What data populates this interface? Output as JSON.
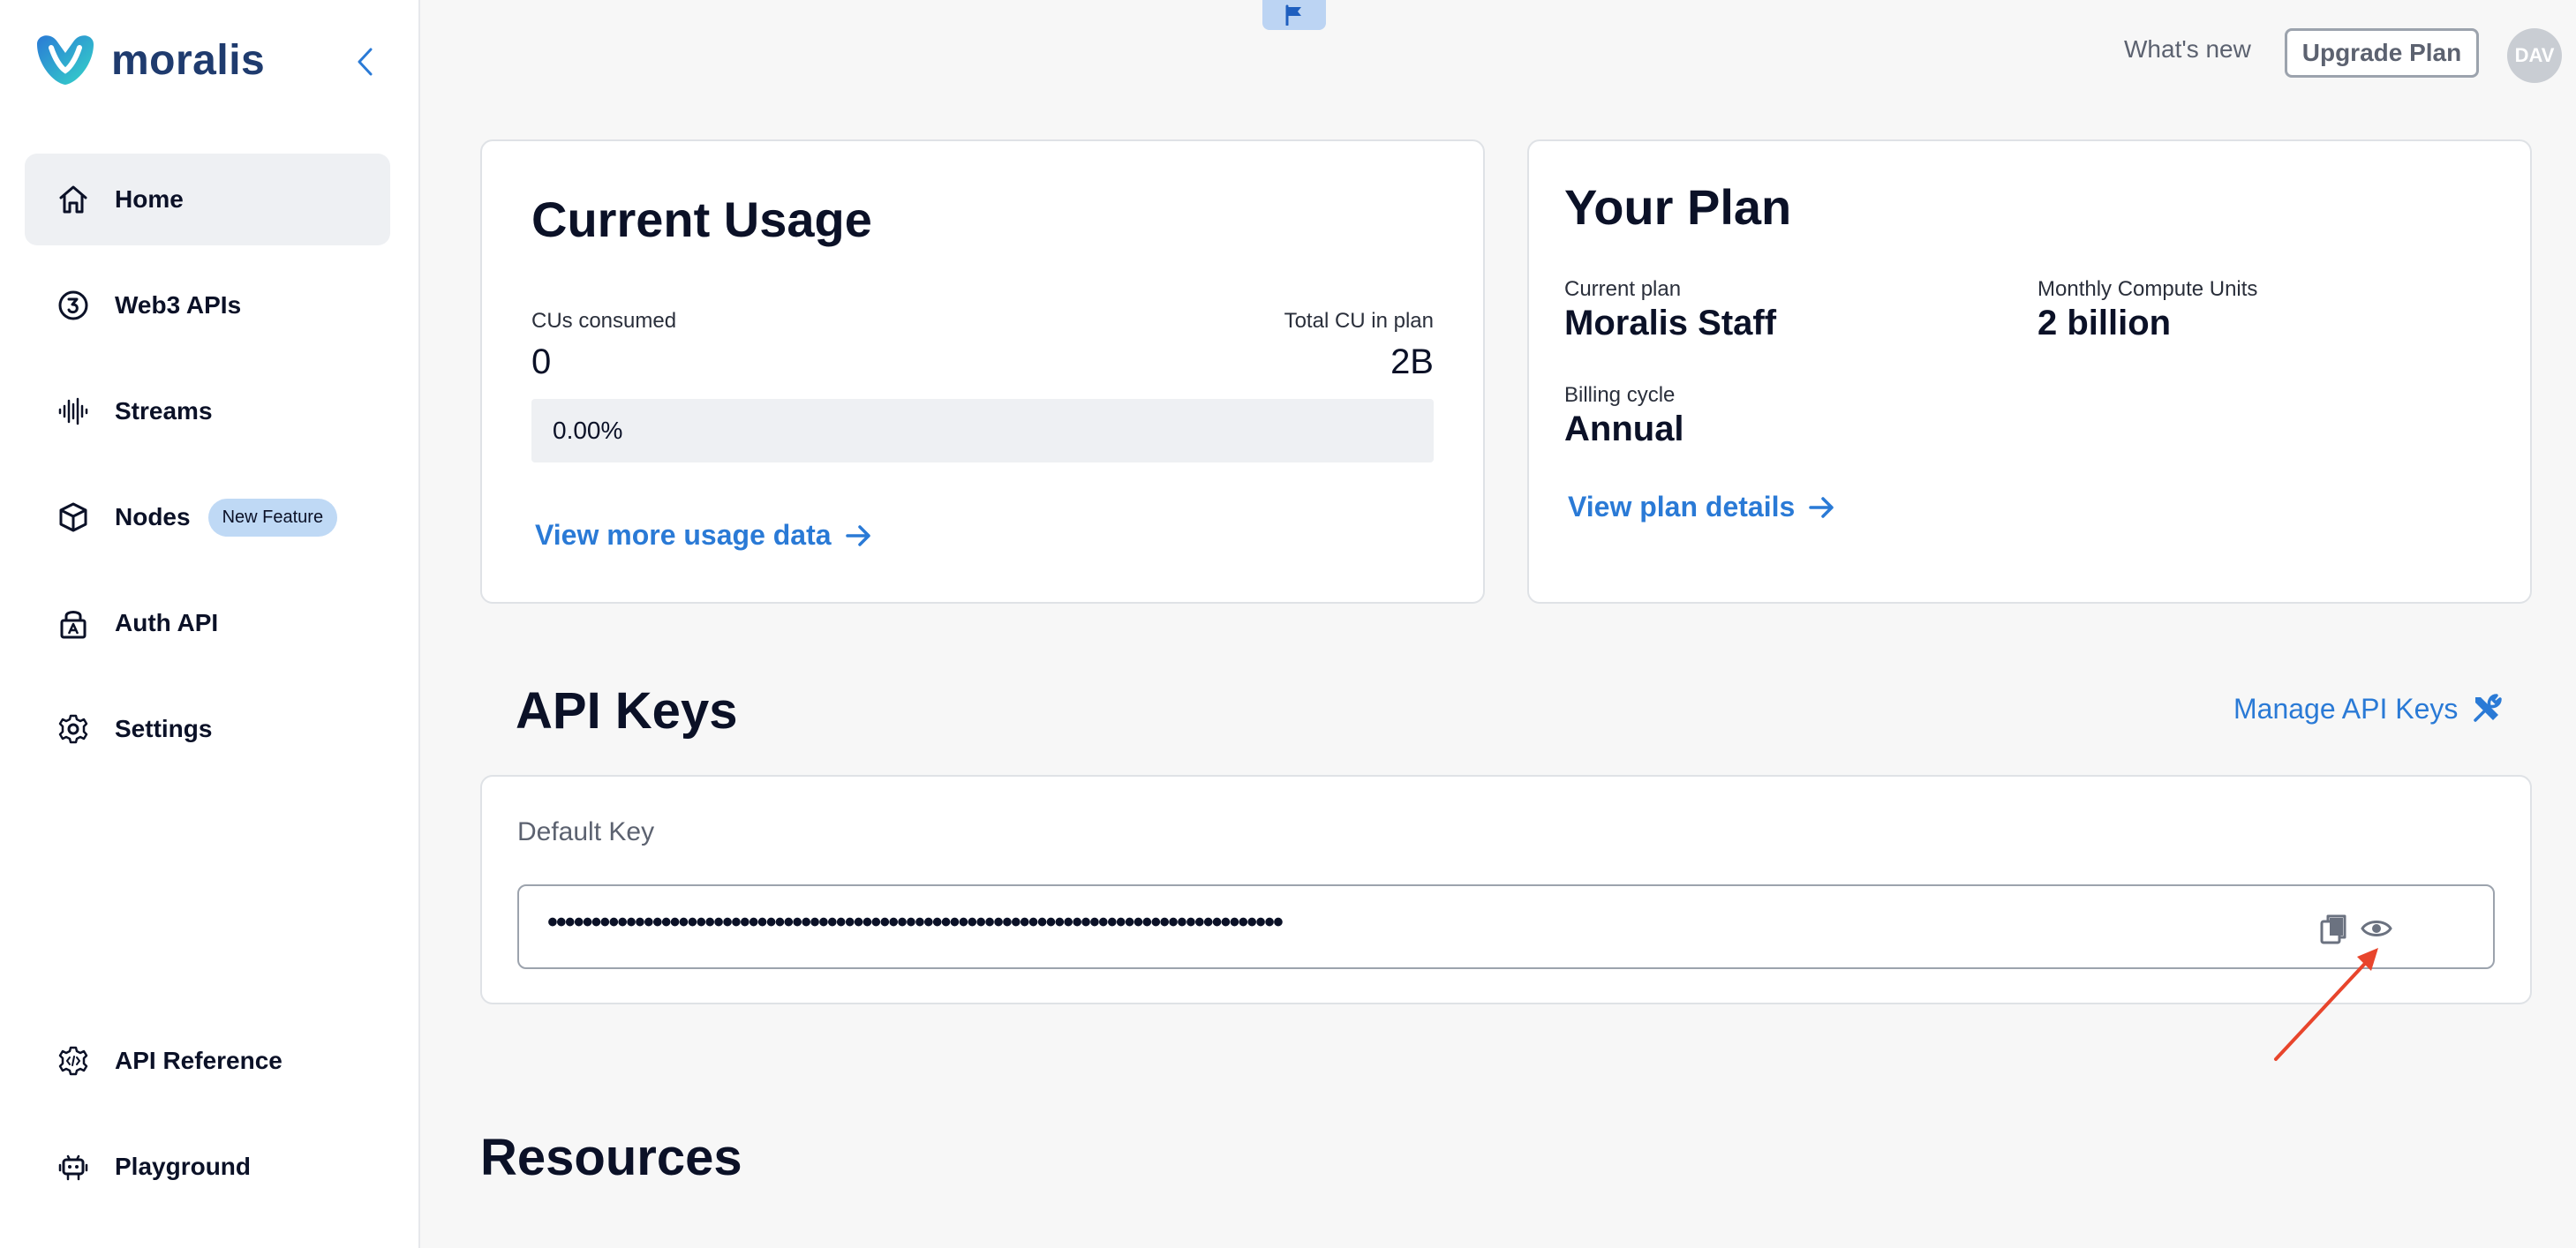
{
  "brand": {
    "name": "moralis"
  },
  "sidebar": {
    "items": [
      {
        "label": "Home",
        "icon": "home-icon",
        "active": true
      },
      {
        "label": "Web3 APIs",
        "icon": "web3-icon"
      },
      {
        "label": "Streams",
        "icon": "streams-icon"
      },
      {
        "label": "Nodes",
        "icon": "cube-icon",
        "badge": "New Feature"
      },
      {
        "label": "Auth API",
        "icon": "lock-icon"
      },
      {
        "label": "Settings",
        "icon": "gear-icon"
      }
    ],
    "bottom_items": [
      {
        "label": "API Reference",
        "icon": "api-reference-icon"
      },
      {
        "label": "Playground",
        "icon": "robot-icon"
      }
    ]
  },
  "topbar": {
    "whats_new": "What's new",
    "upgrade": "Upgrade Plan",
    "avatar": "DAV"
  },
  "usage": {
    "title": "Current Usage",
    "consumed_label": "CUs consumed",
    "consumed_value": "0",
    "total_label": "Total CU in plan",
    "total_value": "2B",
    "percent_text": "0.00%",
    "percent_value": 0,
    "link": "View more usage data"
  },
  "plan": {
    "title": "Your Plan",
    "current_label": "Current plan",
    "current_value": "Moralis Staff",
    "monthly_label": "Monthly Compute Units",
    "monthly_value": "2 billion",
    "billing_label": "Billing cycle",
    "billing_value": "Annual",
    "link": "View plan details"
  },
  "api_keys": {
    "title": "API Keys",
    "manage": "Manage API Keys",
    "key_name": "Default Key",
    "masked_value": "••••••••••••••••••••••••••••••••••••••••••••••••••••••••••••••••••••••••••••••••••••"
  },
  "resources": {
    "title": "Resources"
  },
  "colors": {
    "accent": "#2a7ad6",
    "badge": "#bfd9f5",
    "annotation": "#e8452c"
  }
}
